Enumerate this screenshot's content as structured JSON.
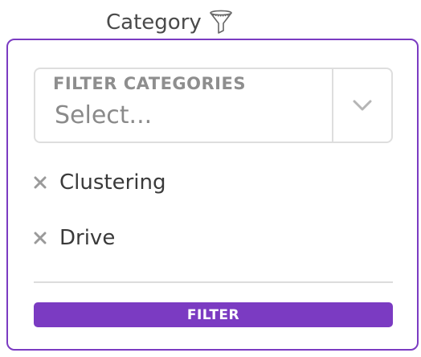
{
  "header": {
    "label": "Category",
    "icon": "funnel-icon"
  },
  "filter_popover": {
    "select": {
      "label": "FILTER CATEGORIES",
      "placeholder": "Select...",
      "toggle_icon": "chevron-down-icon"
    },
    "selected_items": [
      {
        "label": "Clustering",
        "remove_icon": "close-icon"
      },
      {
        "label": "Drive",
        "remove_icon": "close-icon"
      }
    ],
    "filter_button_label": "FILTER"
  },
  "colors": {
    "accent": "#7b3bc2",
    "border": "#dedede",
    "muted_text": "#8e8e8e",
    "text": "#3a3a3a"
  }
}
